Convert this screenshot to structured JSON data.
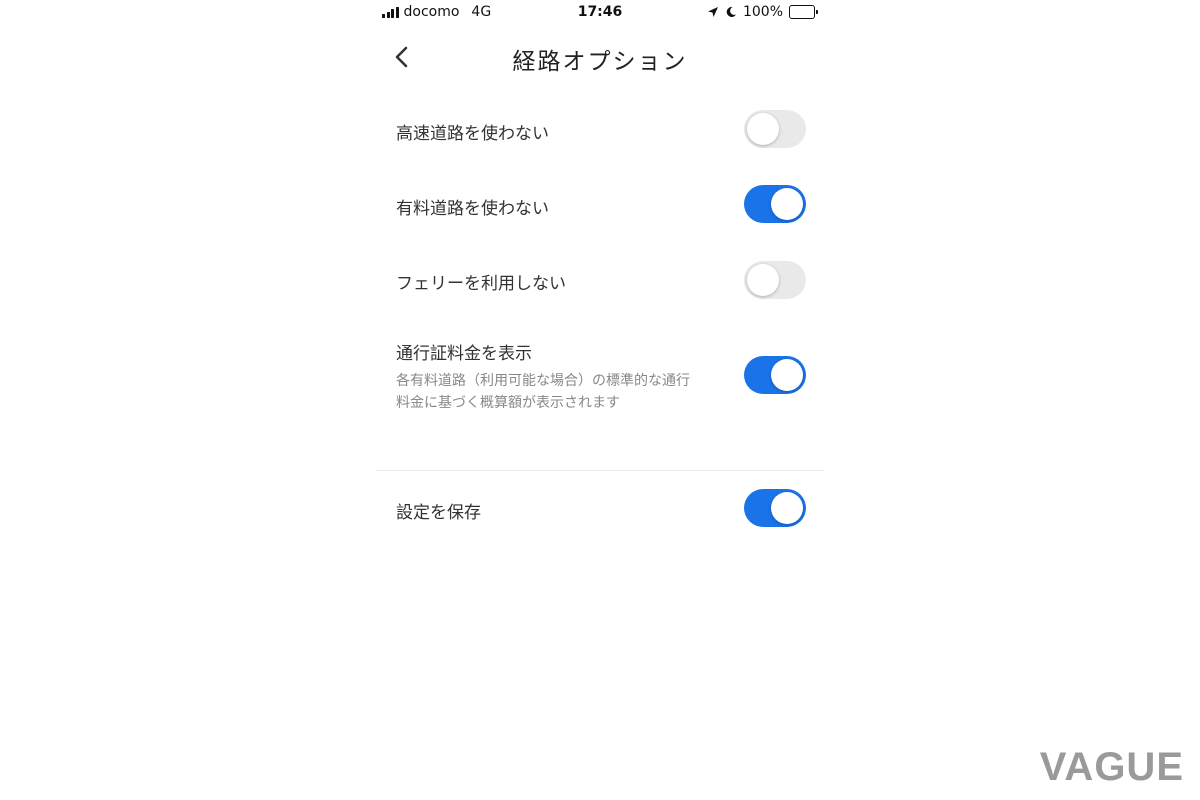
{
  "status_bar": {
    "carrier": "docomo",
    "network": "4G",
    "time": "17:46",
    "battery": "100%",
    "battery_level": 1.0
  },
  "nav": {
    "back_icon": "chevron-left-icon",
    "title": "経路オプション"
  },
  "options": [
    {
      "label": "高速道路を使わない",
      "on": false
    },
    {
      "label": "有料道路を使わない",
      "on": true
    },
    {
      "label": "フェリーを利用しない",
      "on": false
    },
    {
      "label": "通行証料金を表示",
      "description_line1": "各有料道路（利用可能な場合）の標準的な通行",
      "description_line2": "料金に基づく概算額が表示されます",
      "on": true
    }
  ],
  "save_setting": {
    "label": "設定を保存",
    "on": true
  },
  "colors": {
    "toggle_on": "#1a73e8",
    "toggle_off": "#e9e9ea"
  },
  "watermark": "VAGUE"
}
